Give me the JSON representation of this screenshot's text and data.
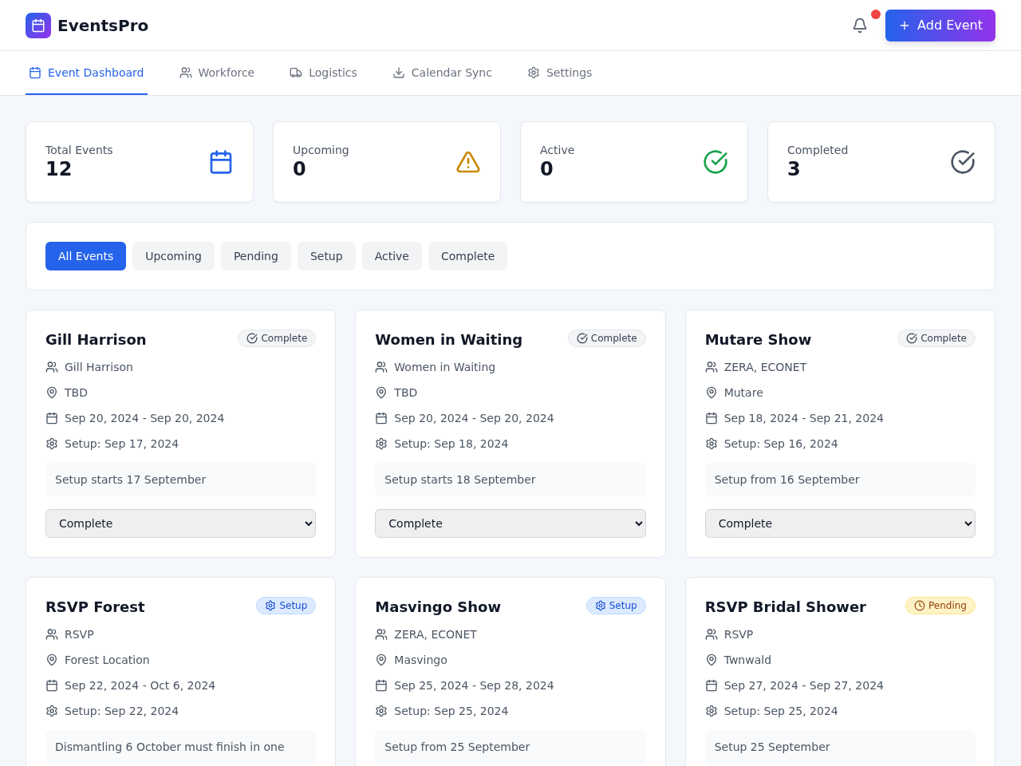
{
  "header": {
    "brand": "EventsPro",
    "notifications_unread": true,
    "add_button": "Add Event"
  },
  "tabs": [
    {
      "label": "Event Dashboard",
      "selected": true
    },
    {
      "label": "Workforce",
      "selected": false
    },
    {
      "label": "Logistics",
      "selected": false
    },
    {
      "label": "Calendar Sync",
      "selected": false
    },
    {
      "label": "Settings",
      "selected": false
    }
  ],
  "stats": [
    {
      "label": "Total Events",
      "value": "12"
    },
    {
      "label": "Upcoming",
      "value": "0"
    },
    {
      "label": "Active",
      "value": "0"
    },
    {
      "label": "Completed",
      "value": "3"
    }
  ],
  "filters": [
    {
      "label": "All Events",
      "selected": true
    },
    {
      "label": "Upcoming",
      "selected": false
    },
    {
      "label": "Pending",
      "selected": false
    },
    {
      "label": "Setup",
      "selected": false
    },
    {
      "label": "Active",
      "selected": false
    },
    {
      "label": "Complete",
      "selected": false
    }
  ],
  "events": [
    {
      "title": "Gill Harrison",
      "badge": {
        "label": "Complete",
        "kind": "complete"
      },
      "organizer": "Gill Harrison",
      "location": "TBD",
      "dates": "Sep 20, 2024 - Sep 20, 2024",
      "setup": "Setup: Sep 17, 2024",
      "note": "Setup starts 17 September",
      "status": "Complete"
    },
    {
      "title": "Women in Waiting",
      "badge": {
        "label": "Complete",
        "kind": "complete"
      },
      "organizer": "Women in Waiting",
      "location": "TBD",
      "dates": "Sep 20, 2024 - Sep 20, 2024",
      "setup": "Setup: Sep 18, 2024",
      "note": "Setup starts 18 September",
      "status": "Complete"
    },
    {
      "title": "Mutare Show",
      "badge": {
        "label": "Complete",
        "kind": "complete"
      },
      "organizer": "ZERA, ECONET",
      "location": "Mutare",
      "dates": "Sep 18, 2024 - Sep 21, 2024",
      "setup": "Setup: Sep 16, 2024",
      "note": "Setup from 16 September",
      "status": "Complete"
    },
    {
      "title": "RSVP Forest",
      "badge": {
        "label": "Setup",
        "kind": "setup"
      },
      "organizer": "RSVP",
      "location": "Forest Location",
      "dates": "Sep 22, 2024 - Oct 6, 2024",
      "setup": "Setup: Sep 22, 2024",
      "note": "Dismantling 6 October must finish in one"
    },
    {
      "title": "Masvingo Show",
      "badge": {
        "label": "Setup",
        "kind": "setup"
      },
      "organizer": "ZERA, ECONET",
      "location": "Masvingo",
      "dates": "Sep 25, 2024 - Sep 28, 2024",
      "setup": "Setup: Sep 25, 2024",
      "note": "Setup from 25 September"
    },
    {
      "title": "RSVP Bridal Shower",
      "badge": {
        "label": "Pending",
        "kind": "pending"
      },
      "organizer": "RSVP",
      "location": "Twnwald",
      "dates": "Sep 27, 2024 - Sep 27, 2024",
      "setup": "Setup: Sep 25, 2024",
      "note": "Setup 25 September"
    }
  ]
}
